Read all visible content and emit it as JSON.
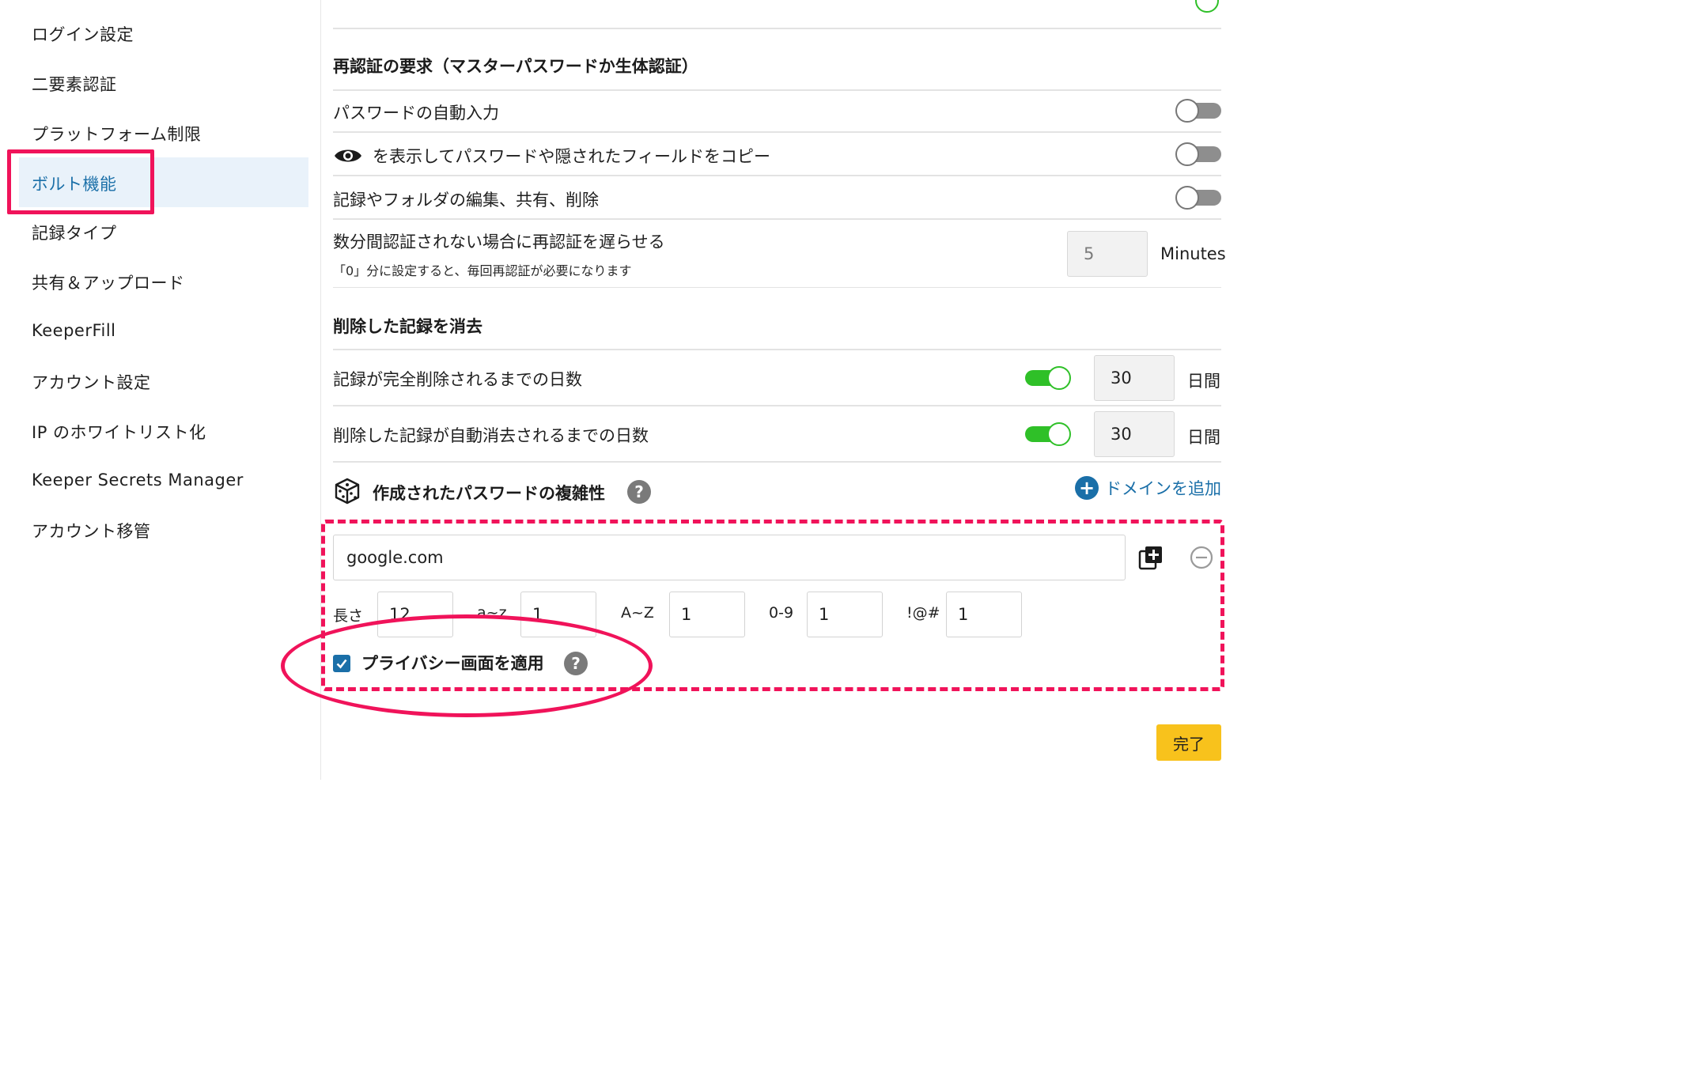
{
  "sidebar": {
    "items": [
      {
        "label": "ログイン設定"
      },
      {
        "label": "二要素認証"
      },
      {
        "label": "プラットフォーム制限"
      },
      {
        "label": "ボルト機能"
      },
      {
        "label": "記録タイプ"
      },
      {
        "label": "共有＆アップロード"
      },
      {
        "label": "KeeperFill"
      },
      {
        "label": "アカウント設定"
      },
      {
        "label": "IP のホワイトリスト化"
      },
      {
        "label": "Keeper Secrets Manager"
      },
      {
        "label": "アカウント移管"
      }
    ],
    "active_item": "ボルト機能"
  },
  "reauth": {
    "title": "再認証の要求（マスターパスワードか生体認証）",
    "rows": [
      {
        "label": "パスワードの自動入力",
        "enabled": false
      },
      {
        "label": "を表示してパスワードや隠されたフィールドをコピー",
        "icon": "eye-icon",
        "enabled": false
      },
      {
        "label": "記録やフォルダの編集、共有、削除",
        "enabled": false
      }
    ],
    "delay": {
      "label": "数分間認証されない場合に再認証を遅らせる",
      "note": "「0」分に設定すると、毎回再認証が必要になります",
      "value": "5",
      "unit": "Minutes"
    }
  },
  "purge": {
    "title": "削除した記録を消去",
    "rows": [
      {
        "label": "記録が完全削除されるまでの日数",
        "enabled": true,
        "value": "30",
        "unit": "日間"
      },
      {
        "label": "削除した記録が自動消去されるまでの日数",
        "enabled": true,
        "value": "30",
        "unit": "日間"
      }
    ]
  },
  "complexity": {
    "title": "作成されたパスワードの複雑性",
    "help": "?",
    "add_domain_plus": "+",
    "add_domain_label": "ドメインを追加",
    "domain": "google.com",
    "fields": {
      "length_label": "長さ",
      "length_value": "12",
      "lower_label": "a~z",
      "lower_value": "1",
      "upper_label": "A~Z",
      "upper_value": "1",
      "digits_label": "0-9",
      "digits_value": "1",
      "symbols_label": "!@#",
      "symbols_value": "1"
    },
    "privacy_label": "プライバシー画面を適用",
    "privacy_checked": true,
    "privacy_help": "?"
  },
  "footer": {
    "done_label": "完了"
  },
  "colors": {
    "accent": "#1a6fa8",
    "toggle_on": "#2fc028",
    "annotation": "#f0135a",
    "done_button": "#f8c21c"
  }
}
